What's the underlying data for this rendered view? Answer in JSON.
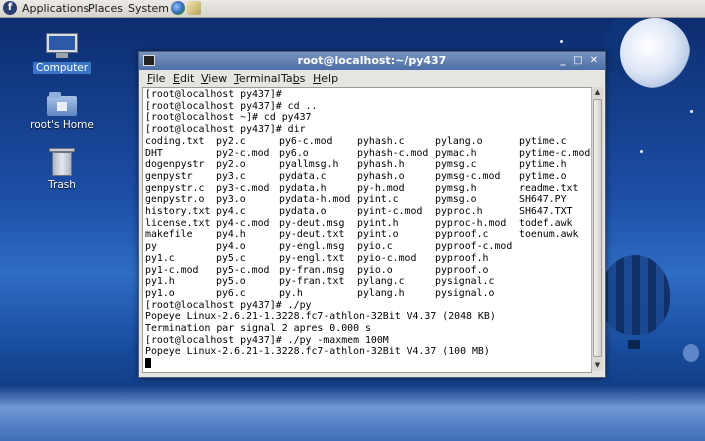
{
  "panel": {
    "menus": [
      "Applications",
      "Places",
      "System"
    ],
    "icons": [
      "fedora-logo",
      "web-browser-icon",
      "mail-icon"
    ]
  },
  "desktop": {
    "icons": [
      {
        "label": "Computer",
        "icon": "computer-icon",
        "selected": true
      },
      {
        "label": "root's Home",
        "icon": "home-folder-icon",
        "selected": false
      },
      {
        "label": "Trash",
        "icon": "trash-icon",
        "selected": false
      }
    ]
  },
  "window": {
    "title": "root@localhost:~/py437",
    "menu": [
      "File",
      "Edit",
      "View",
      "Terminal",
      "Tabs",
      "Help"
    ],
    "menu_mnemonics": [
      "F",
      "E",
      "V",
      "T",
      "b",
      "H"
    ]
  },
  "terminal": {
    "lines_before": [
      "[root@localhost py437]#",
      "[root@localhost py437]# cd ..",
      "[root@localhost ~]# cd py437",
      "[root@localhost py437]# dir"
    ],
    "dir_rows": [
      [
        "coding.txt",
        "py2.c",
        "py6-c.mod",
        "pyhash.c",
        "pylang.o",
        "pytime.c"
      ],
      [
        "DHT",
        "py2-c.mod",
        "py6.o",
        "pyhash-c.mod",
        "pymac.h",
        "pytime-c.mod"
      ],
      [
        "dogenpystr",
        "py2.o",
        "pyallmsg.h",
        "pyhash.h",
        "pymsg.c",
        "pytime.h"
      ],
      [
        "genpystr",
        "py3.c",
        "pydata.c",
        "pyhash.o",
        "pymsg-c.mod",
        "pytime.o"
      ],
      [
        "genpystr.c",
        "py3-c.mod",
        "pydata.h",
        "py-h.mod",
        "pymsg.h",
        "readme.txt"
      ],
      [
        "genpystr.o",
        "py3.o",
        "pydata-h.mod",
        "pyint.c",
        "pymsg.o",
        "SH647.PY"
      ],
      [
        "history.txt",
        "py4.c",
        "pydata.o",
        "pyint-c.mod",
        "pyproc.h",
        "SH647.TXT"
      ],
      [
        "license.txt",
        "py4-c.mod",
        "py-deut.msg",
        "pyint.h",
        "pyproc-h.mod",
        "todef.awk"
      ],
      [
        "makefile",
        "py4.h",
        "py-deut.txt",
        "pyint.o",
        "pyproof.c",
        "toenum.awk"
      ],
      [
        "py",
        "py4.o",
        "py-engl.msg",
        "pyio.c",
        "pyproof-c.mod",
        ""
      ],
      [
        "py1.c",
        "py5.c",
        "py-engl.txt",
        "pyio-c.mod",
        "pyproof.h",
        ""
      ],
      [
        "py1-c.mod",
        "py5-c.mod",
        "py-fran.msg",
        "pyio.o",
        "pyproof.o",
        ""
      ],
      [
        "py1.h",
        "py5.o",
        "py-fran.txt",
        "pylang.c",
        "pysignal.c",
        ""
      ],
      [
        "py1.o",
        "py6.c",
        "py.h",
        "pylang.h",
        "pysignal.o",
        ""
      ]
    ],
    "lines_after": [
      "[root@localhost py437]# ./py",
      "Popeye Linux-2.6.21-1.3228.fc7-athlon-32Bit V4.37 (2048 KB)",
      "Termination par signal 2 apres 0.000 s",
      "[root@localhost py437]# ./py -maxmem 100M",
      "Popeye Linux-2.6.21-1.3228.fc7-athlon-32Bit V4.37 (100 MB)"
    ]
  }
}
